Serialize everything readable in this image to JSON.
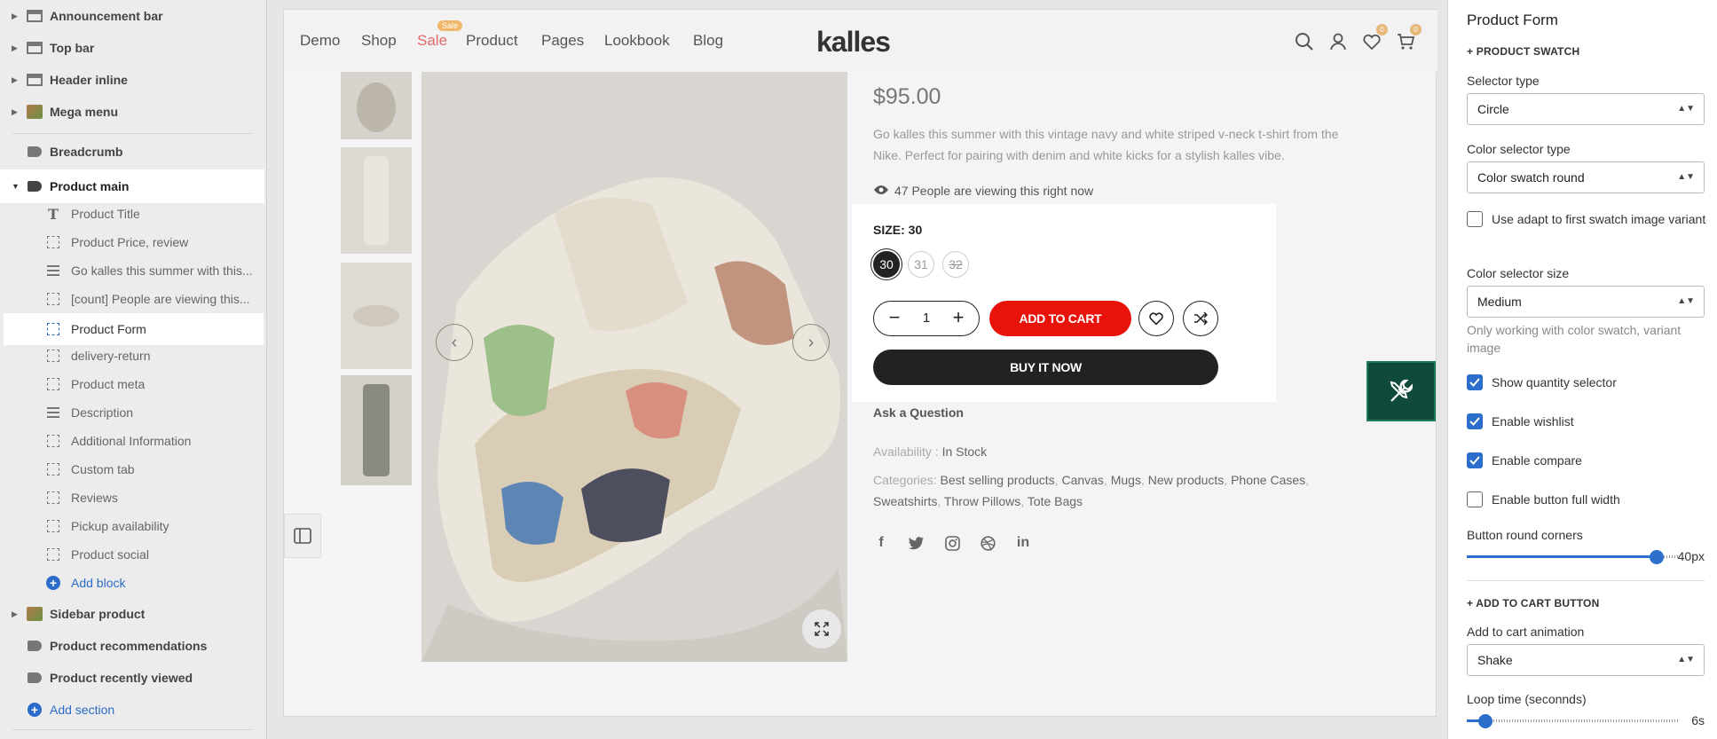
{
  "sidebar": {
    "sections_top": [
      {
        "label": "Announcement bar"
      },
      {
        "label": "Top bar"
      },
      {
        "label": "Header inline"
      },
      {
        "label": "Mega menu"
      }
    ],
    "breadcrumb": "Breadcrumb",
    "product_main": "Product main",
    "blocks": [
      {
        "label": "Product Title"
      },
      {
        "label": "Product Price, review"
      },
      {
        "label": "Go kalles this summer with this..."
      },
      {
        "label": "[count] People are viewing this..."
      },
      {
        "label": "Product Form"
      },
      {
        "label": "delivery-return"
      },
      {
        "label": "Product meta"
      },
      {
        "label": "Description"
      },
      {
        "label": "Additional Information"
      },
      {
        "label": "Custom tab"
      },
      {
        "label": "Reviews"
      },
      {
        "label": "Pickup availability"
      },
      {
        "label": "Product social"
      }
    ],
    "add_block": "Add block",
    "sections_bottom": [
      {
        "label": "Sidebar product"
      },
      {
        "label": "Product recommendations"
      },
      {
        "label": "Product recently viewed"
      }
    ],
    "add_section": "Add section"
  },
  "store": {
    "nav": [
      "Demo",
      "Shop",
      "Sale",
      "Product",
      "Pages",
      "Lookbook",
      "Blog"
    ],
    "sale_badge": "Sale",
    "logo": "kalles",
    "wishlist_count": "0",
    "cart_count": "0",
    "price": "$95.00",
    "description": "Go kalles this summer with this vintage navy and white striped v-neck t-shirt from the Nike. Perfect for pairing with denim and white kicks for a stylish kalles vibe.",
    "viewing": "47 People are viewing this right now",
    "size_label": "SIZE: 30",
    "sizes": [
      "30",
      "31",
      "32"
    ],
    "qty": "1",
    "add_to_cart": "ADD TO CART",
    "buy_now": "BUY IT NOW",
    "ask": "Ask a Question",
    "availability_label": "Availability :",
    "availability_value": "In Stock",
    "categories_label": "Categories:",
    "categories": [
      "Best selling products",
      "Canvas",
      "Mugs",
      "New products",
      "Phone Cases",
      "Sweatshirts",
      "Throw Pillows",
      "Tote Bags"
    ]
  },
  "panel": {
    "title": "Product Form",
    "swatch_heading": "+ PRODUCT SWATCH",
    "selector_type_label": "Selector type",
    "selector_type_value": "Circle",
    "color_selector_type_label": "Color selector type",
    "color_selector_type_value": "Color swatch round",
    "adapt_label": "Use adapt to first swatch image variant",
    "color_selector_size_label": "Color selector size",
    "color_selector_size_value": "Medium",
    "color_size_help": "Only working with color swatch, variant image",
    "show_qty_label": "Show quantity selector",
    "wishlist_label": "Enable wishlist",
    "compare_label": "Enable compare",
    "full_width_label": "Enable button full width",
    "round_corners_label": "Button round corners",
    "round_corners_value": "40px",
    "round_corners_fraction": 0.92,
    "atc_heading": "+ ADD TO CART BUTTON",
    "animation_label": "Add to cart animation",
    "animation_value": "Shake",
    "loop_label": "Loop time (seconnds)",
    "loop_value": "6s",
    "loop_fraction": 0.06,
    "checks": {
      "adapt": false,
      "show_qty": true,
      "wishlist": true,
      "compare": true,
      "full_width": false
    }
  }
}
